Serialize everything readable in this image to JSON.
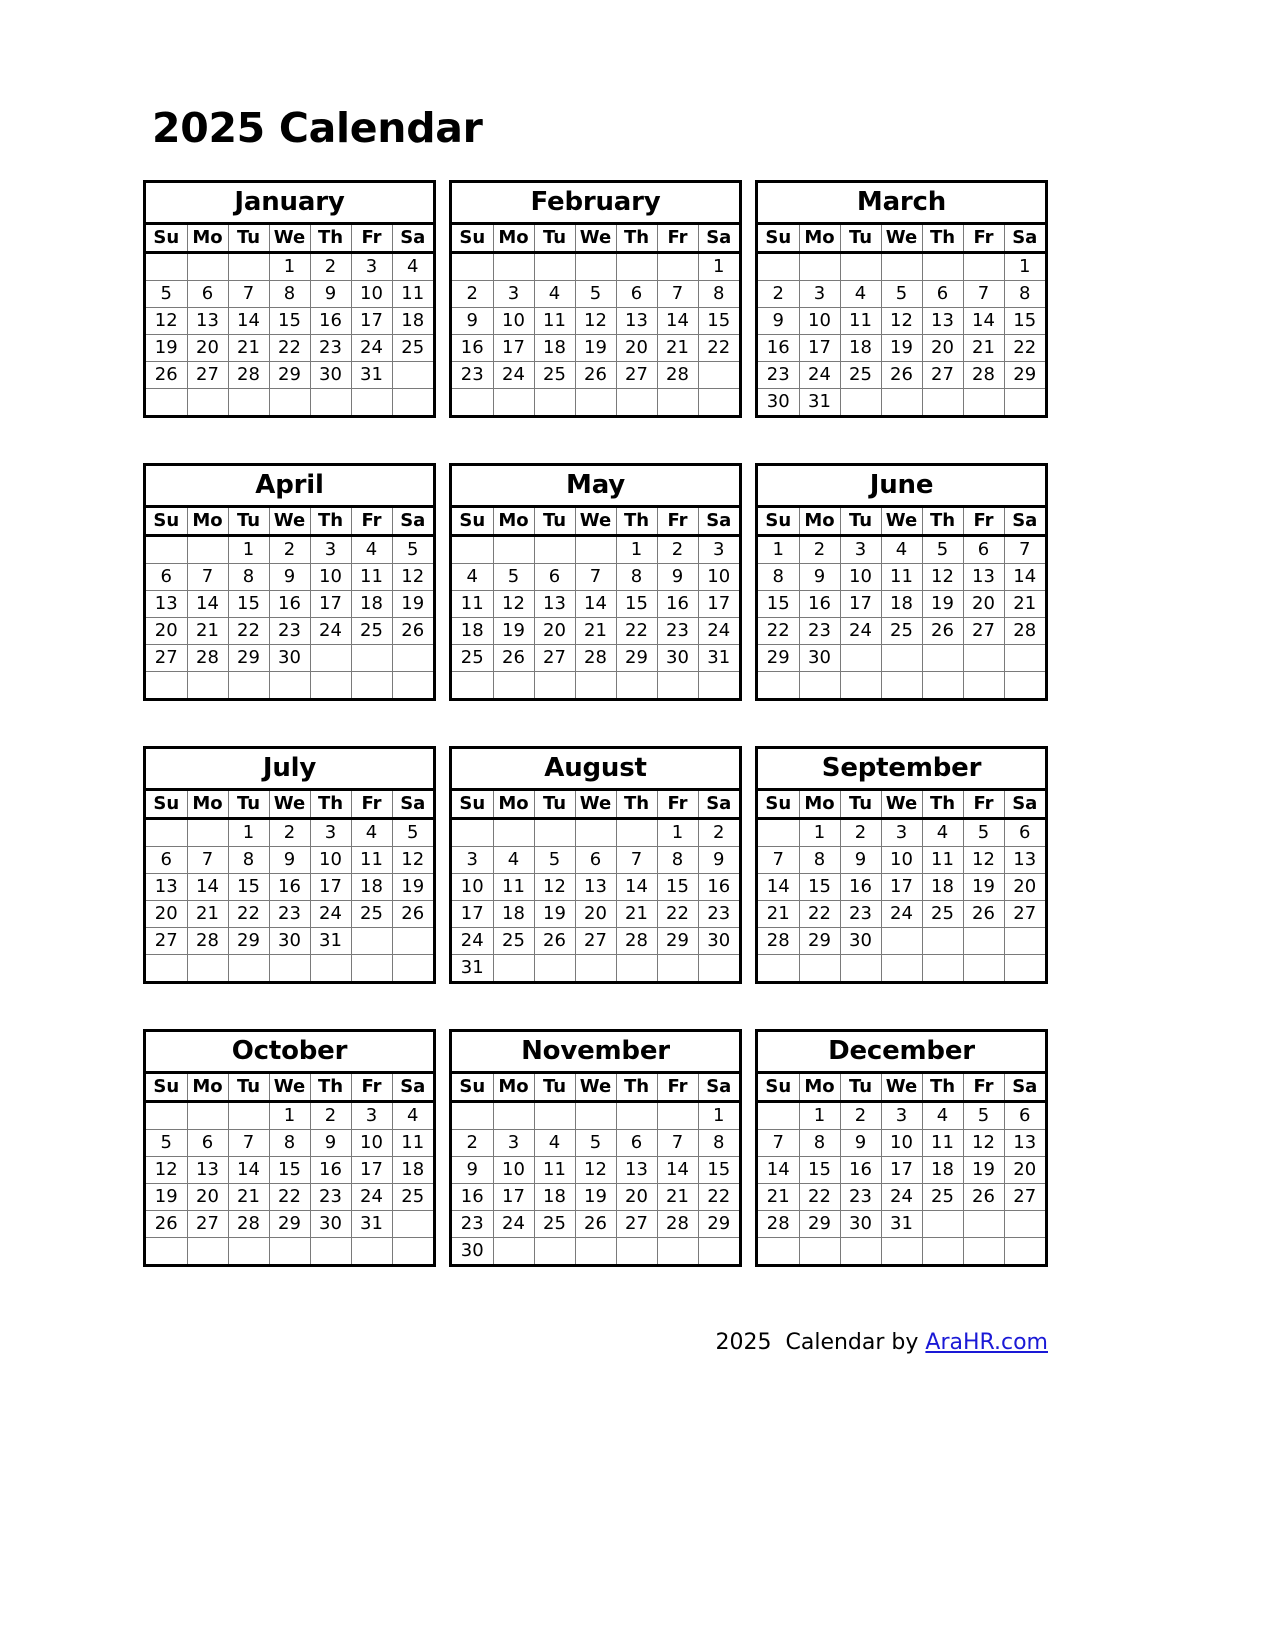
{
  "title": "2025 Calendar",
  "year": "2025",
  "weekday_headers": [
    "Su",
    "Mo",
    "Tu",
    "We",
    "Th",
    "Fr",
    "Sa"
  ],
  "footer": {
    "year": "2025",
    "text": "Calendar by",
    "link_label": "AraHR.com",
    "link_color": "#1a19d6"
  },
  "colors": {
    "border": "#000000",
    "grid_line": "#7a7a7a",
    "background": "#ffffff",
    "text": "#000000"
  },
  "months": [
    {
      "name": "January",
      "weeks": [
        [
          "",
          "",
          "",
          "1",
          "2",
          "3",
          "4"
        ],
        [
          "5",
          "6",
          "7",
          "8",
          "9",
          "10",
          "11"
        ],
        [
          "12",
          "13",
          "14",
          "15",
          "16",
          "17",
          "18"
        ],
        [
          "19",
          "20",
          "21",
          "22",
          "23",
          "24",
          "25"
        ],
        [
          "26",
          "27",
          "28",
          "29",
          "30",
          "31",
          ""
        ],
        [
          "",
          "",
          "",
          "",
          "",
          "",
          ""
        ]
      ]
    },
    {
      "name": "February",
      "weeks": [
        [
          "",
          "",
          "",
          "",
          "",
          "",
          "1"
        ],
        [
          "2",
          "3",
          "4",
          "5",
          "6",
          "7",
          "8"
        ],
        [
          "9",
          "10",
          "11",
          "12",
          "13",
          "14",
          "15"
        ],
        [
          "16",
          "17",
          "18",
          "19",
          "20",
          "21",
          "22"
        ],
        [
          "23",
          "24",
          "25",
          "26",
          "27",
          "28",
          ""
        ],
        [
          "",
          "",
          "",
          "",
          "",
          "",
          ""
        ]
      ]
    },
    {
      "name": "March",
      "weeks": [
        [
          "",
          "",
          "",
          "",
          "",
          "",
          "1"
        ],
        [
          "2",
          "3",
          "4",
          "5",
          "6",
          "7",
          "8"
        ],
        [
          "9",
          "10",
          "11",
          "12",
          "13",
          "14",
          "15"
        ],
        [
          "16",
          "17",
          "18",
          "19",
          "20",
          "21",
          "22"
        ],
        [
          "23",
          "24",
          "25",
          "26",
          "27",
          "28",
          "29"
        ],
        [
          "30",
          "31",
          "",
          "",
          "",
          "",
          ""
        ]
      ]
    },
    {
      "name": "April",
      "weeks": [
        [
          "",
          "",
          "1",
          "2",
          "3",
          "4",
          "5"
        ],
        [
          "6",
          "7",
          "8",
          "9",
          "10",
          "11",
          "12"
        ],
        [
          "13",
          "14",
          "15",
          "16",
          "17",
          "18",
          "19"
        ],
        [
          "20",
          "21",
          "22",
          "23",
          "24",
          "25",
          "26"
        ],
        [
          "27",
          "28",
          "29",
          "30",
          "",
          "",
          ""
        ],
        [
          "",
          "",
          "",
          "",
          "",
          "",
          ""
        ]
      ]
    },
    {
      "name": "May",
      "weeks": [
        [
          "",
          "",
          "",
          "",
          "1",
          "2",
          "3"
        ],
        [
          "4",
          "5",
          "6",
          "7",
          "8",
          "9",
          "10"
        ],
        [
          "11",
          "12",
          "13",
          "14",
          "15",
          "16",
          "17"
        ],
        [
          "18",
          "19",
          "20",
          "21",
          "22",
          "23",
          "24"
        ],
        [
          "25",
          "26",
          "27",
          "28",
          "29",
          "30",
          "31"
        ],
        [
          "",
          "",
          "",
          "",
          "",
          "",
          ""
        ]
      ]
    },
    {
      "name": "June",
      "weeks": [
        [
          "1",
          "2",
          "3",
          "4",
          "5",
          "6",
          "7"
        ],
        [
          "8",
          "9",
          "10",
          "11",
          "12",
          "13",
          "14"
        ],
        [
          "15",
          "16",
          "17",
          "18",
          "19",
          "20",
          "21"
        ],
        [
          "22",
          "23",
          "24",
          "25",
          "26",
          "27",
          "28"
        ],
        [
          "29",
          "30",
          "",
          "",
          "",
          "",
          ""
        ],
        [
          "",
          "",
          "",
          "",
          "",
          "",
          ""
        ]
      ]
    },
    {
      "name": "July",
      "weeks": [
        [
          "",
          "",
          "1",
          "2",
          "3",
          "4",
          "5"
        ],
        [
          "6",
          "7",
          "8",
          "9",
          "10",
          "11",
          "12"
        ],
        [
          "13",
          "14",
          "15",
          "16",
          "17",
          "18",
          "19"
        ],
        [
          "20",
          "21",
          "22",
          "23",
          "24",
          "25",
          "26"
        ],
        [
          "27",
          "28",
          "29",
          "30",
          "31",
          "",
          ""
        ],
        [
          "",
          "",
          "",
          "",
          "",
          "",
          ""
        ]
      ]
    },
    {
      "name": "August",
      "weeks": [
        [
          "",
          "",
          "",
          "",
          "",
          "1",
          "2"
        ],
        [
          "3",
          "4",
          "5",
          "6",
          "7",
          "8",
          "9"
        ],
        [
          "10",
          "11",
          "12",
          "13",
          "14",
          "15",
          "16"
        ],
        [
          "17",
          "18",
          "19",
          "20",
          "21",
          "22",
          "23"
        ],
        [
          "24",
          "25",
          "26",
          "27",
          "28",
          "29",
          "30"
        ],
        [
          "31",
          "",
          "",
          "",
          "",
          "",
          ""
        ]
      ]
    },
    {
      "name": "September",
      "weeks": [
        [
          "",
          "1",
          "2",
          "3",
          "4",
          "5",
          "6"
        ],
        [
          "7",
          "8",
          "9",
          "10",
          "11",
          "12",
          "13"
        ],
        [
          "14",
          "15",
          "16",
          "17",
          "18",
          "19",
          "20"
        ],
        [
          "21",
          "22",
          "23",
          "24",
          "25",
          "26",
          "27"
        ],
        [
          "28",
          "29",
          "30",
          "",
          "",
          "",
          ""
        ],
        [
          "",
          "",
          "",
          "",
          "",
          "",
          ""
        ]
      ]
    },
    {
      "name": "October",
      "weeks": [
        [
          "",
          "",
          "",
          "1",
          "2",
          "3",
          "4"
        ],
        [
          "5",
          "6",
          "7",
          "8",
          "9",
          "10",
          "11"
        ],
        [
          "12",
          "13",
          "14",
          "15",
          "16",
          "17",
          "18"
        ],
        [
          "19",
          "20",
          "21",
          "22",
          "23",
          "24",
          "25"
        ],
        [
          "26",
          "27",
          "28",
          "29",
          "30",
          "31",
          ""
        ],
        [
          "",
          "",
          "",
          "",
          "",
          "",
          ""
        ]
      ]
    },
    {
      "name": "November",
      "weeks": [
        [
          "",
          "",
          "",
          "",
          "",
          "",
          "1"
        ],
        [
          "2",
          "3",
          "4",
          "5",
          "6",
          "7",
          "8"
        ],
        [
          "9",
          "10",
          "11",
          "12",
          "13",
          "14",
          "15"
        ],
        [
          "16",
          "17",
          "18",
          "19",
          "20",
          "21",
          "22"
        ],
        [
          "23",
          "24",
          "25",
          "26",
          "27",
          "28",
          "29"
        ],
        [
          "30",
          "",
          "",
          "",
          "",
          "",
          ""
        ]
      ]
    },
    {
      "name": "December",
      "weeks": [
        [
          "",
          "1",
          "2",
          "3",
          "4",
          "5",
          "6"
        ],
        [
          "7",
          "8",
          "9",
          "10",
          "11",
          "12",
          "13"
        ],
        [
          "14",
          "15",
          "16",
          "17",
          "18",
          "19",
          "20"
        ],
        [
          "21",
          "22",
          "23",
          "24",
          "25",
          "26",
          "27"
        ],
        [
          "28",
          "29",
          "30",
          "31",
          "",
          "",
          ""
        ],
        [
          "",
          "",
          "",
          "",
          "",
          "",
          ""
        ]
      ]
    }
  ]
}
